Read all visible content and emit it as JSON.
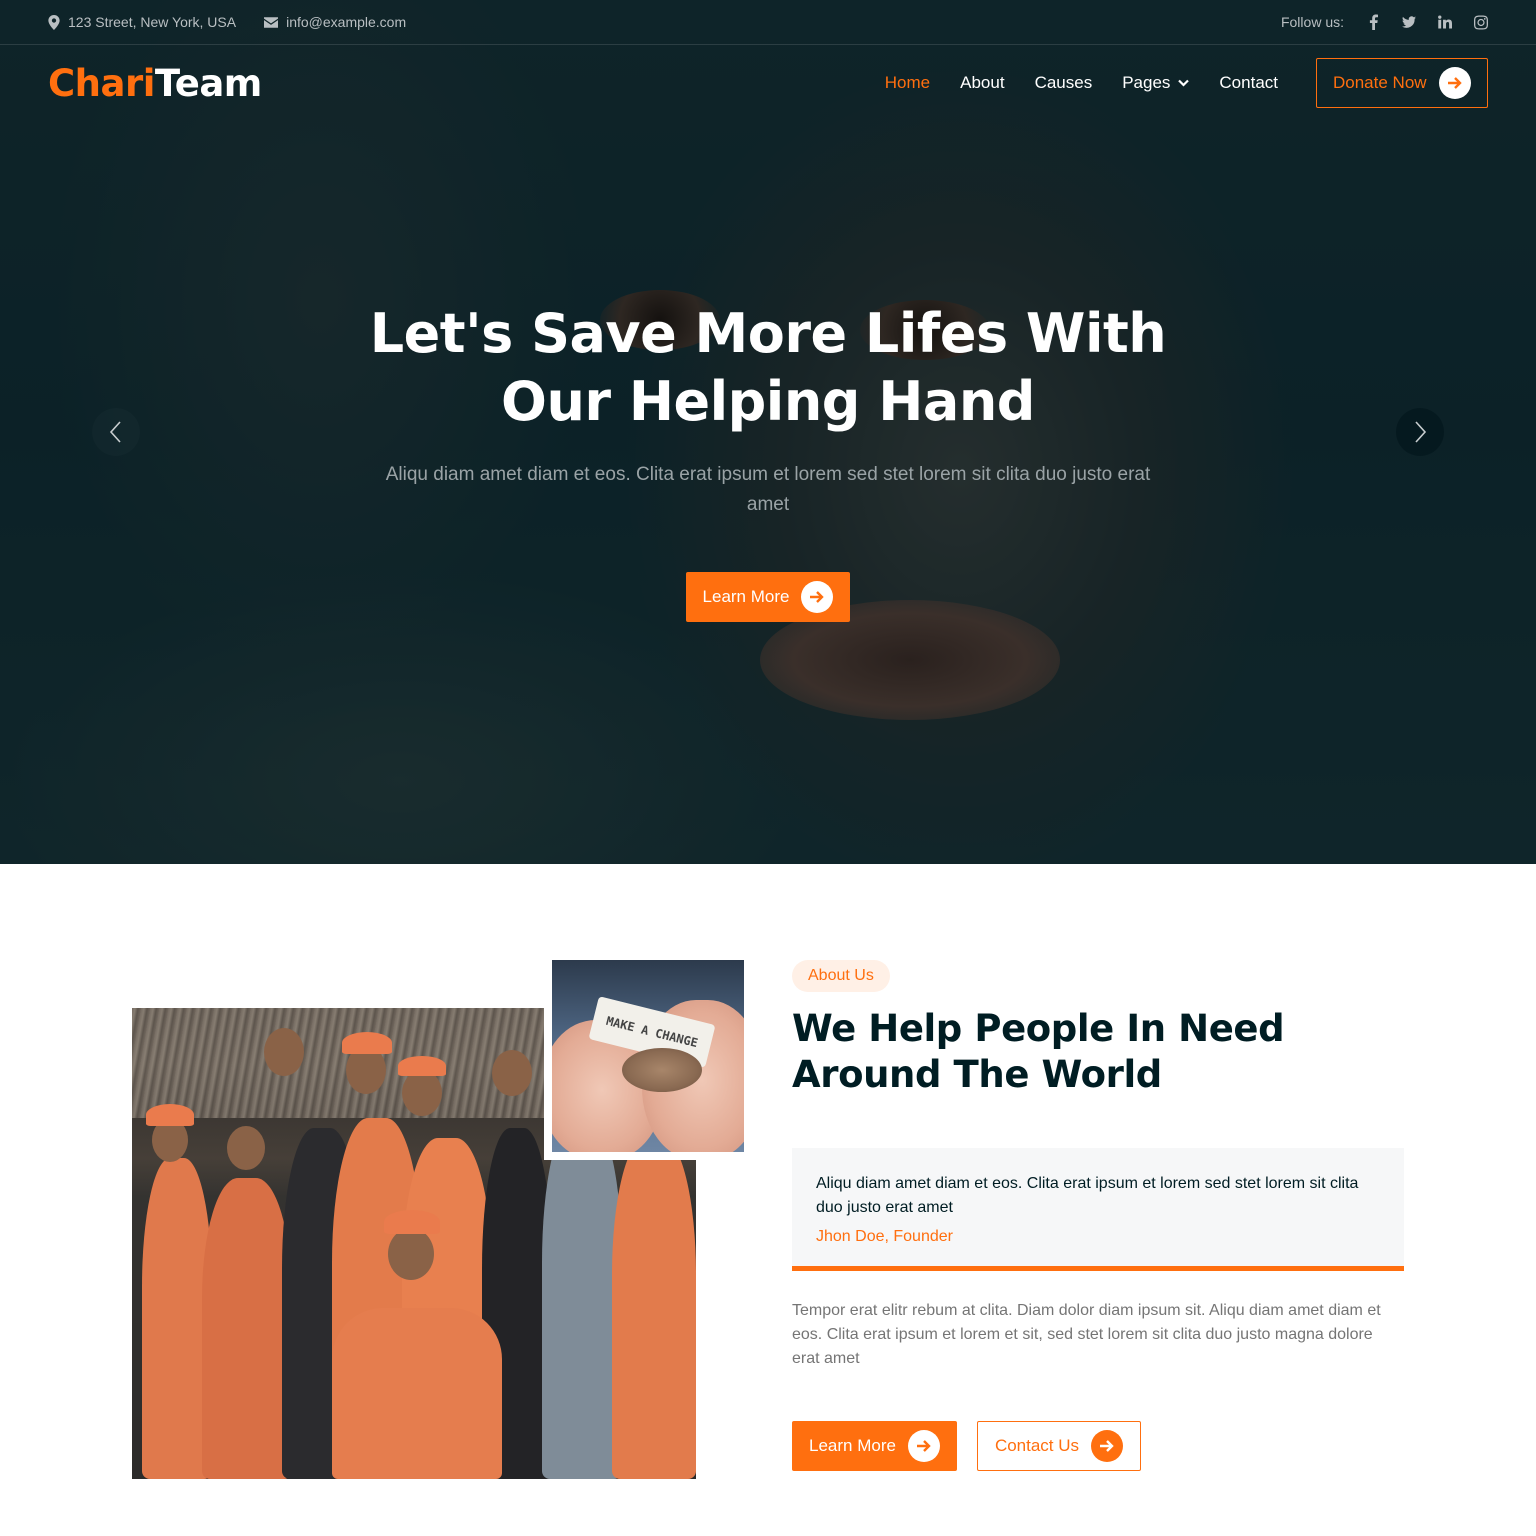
{
  "topbar": {
    "address": "123 Street, New York, USA",
    "email": "info@example.com",
    "follow_label": "Follow us:",
    "social": [
      "facebook-icon",
      "twitter-icon",
      "linkedin-icon",
      "instagram-icon"
    ]
  },
  "brand": {
    "part1": "Chari",
    "part2": "Team"
  },
  "nav": {
    "items": [
      {
        "label": "Home",
        "active": true
      },
      {
        "label": "About"
      },
      {
        "label": "Causes"
      },
      {
        "label": "Pages",
        "dropdown": true
      },
      {
        "label": "Contact"
      }
    ],
    "donate_label": "Donate Now"
  },
  "hero": {
    "title_line1": "Let's Save More Lifes With",
    "title_line2": "Our Helping Hand",
    "subtitle": "Aliqu diam amet diam et eos. Clita erat ipsum et lorem sed stet lorem sit clita duo justo erat amet",
    "cta_label": "Learn More"
  },
  "about": {
    "badge": "About Us",
    "title": "We Help People In Need Around The World",
    "quote": "Aliqu diam amet diam et eos. Clita erat ipsum et lorem sed stet lorem sit clita duo justo erat amet",
    "quote_author": "Jhon Doe, Founder",
    "paragraph": "Tempor erat elitr rebum at clita. Diam dolor diam ipsum sit. Aliqu diam amet diam et eos. Clita erat ipsum et lorem et sit, sed stet lorem sit clita duo justo magna dolore erat amet",
    "learn_label": "Learn More",
    "contact_label": "Contact Us",
    "coins_note": "MAKE A CHANGE"
  },
  "colors": {
    "accent": "#ff6f0f",
    "dark": "#001d23",
    "text_muted": "#757575"
  }
}
